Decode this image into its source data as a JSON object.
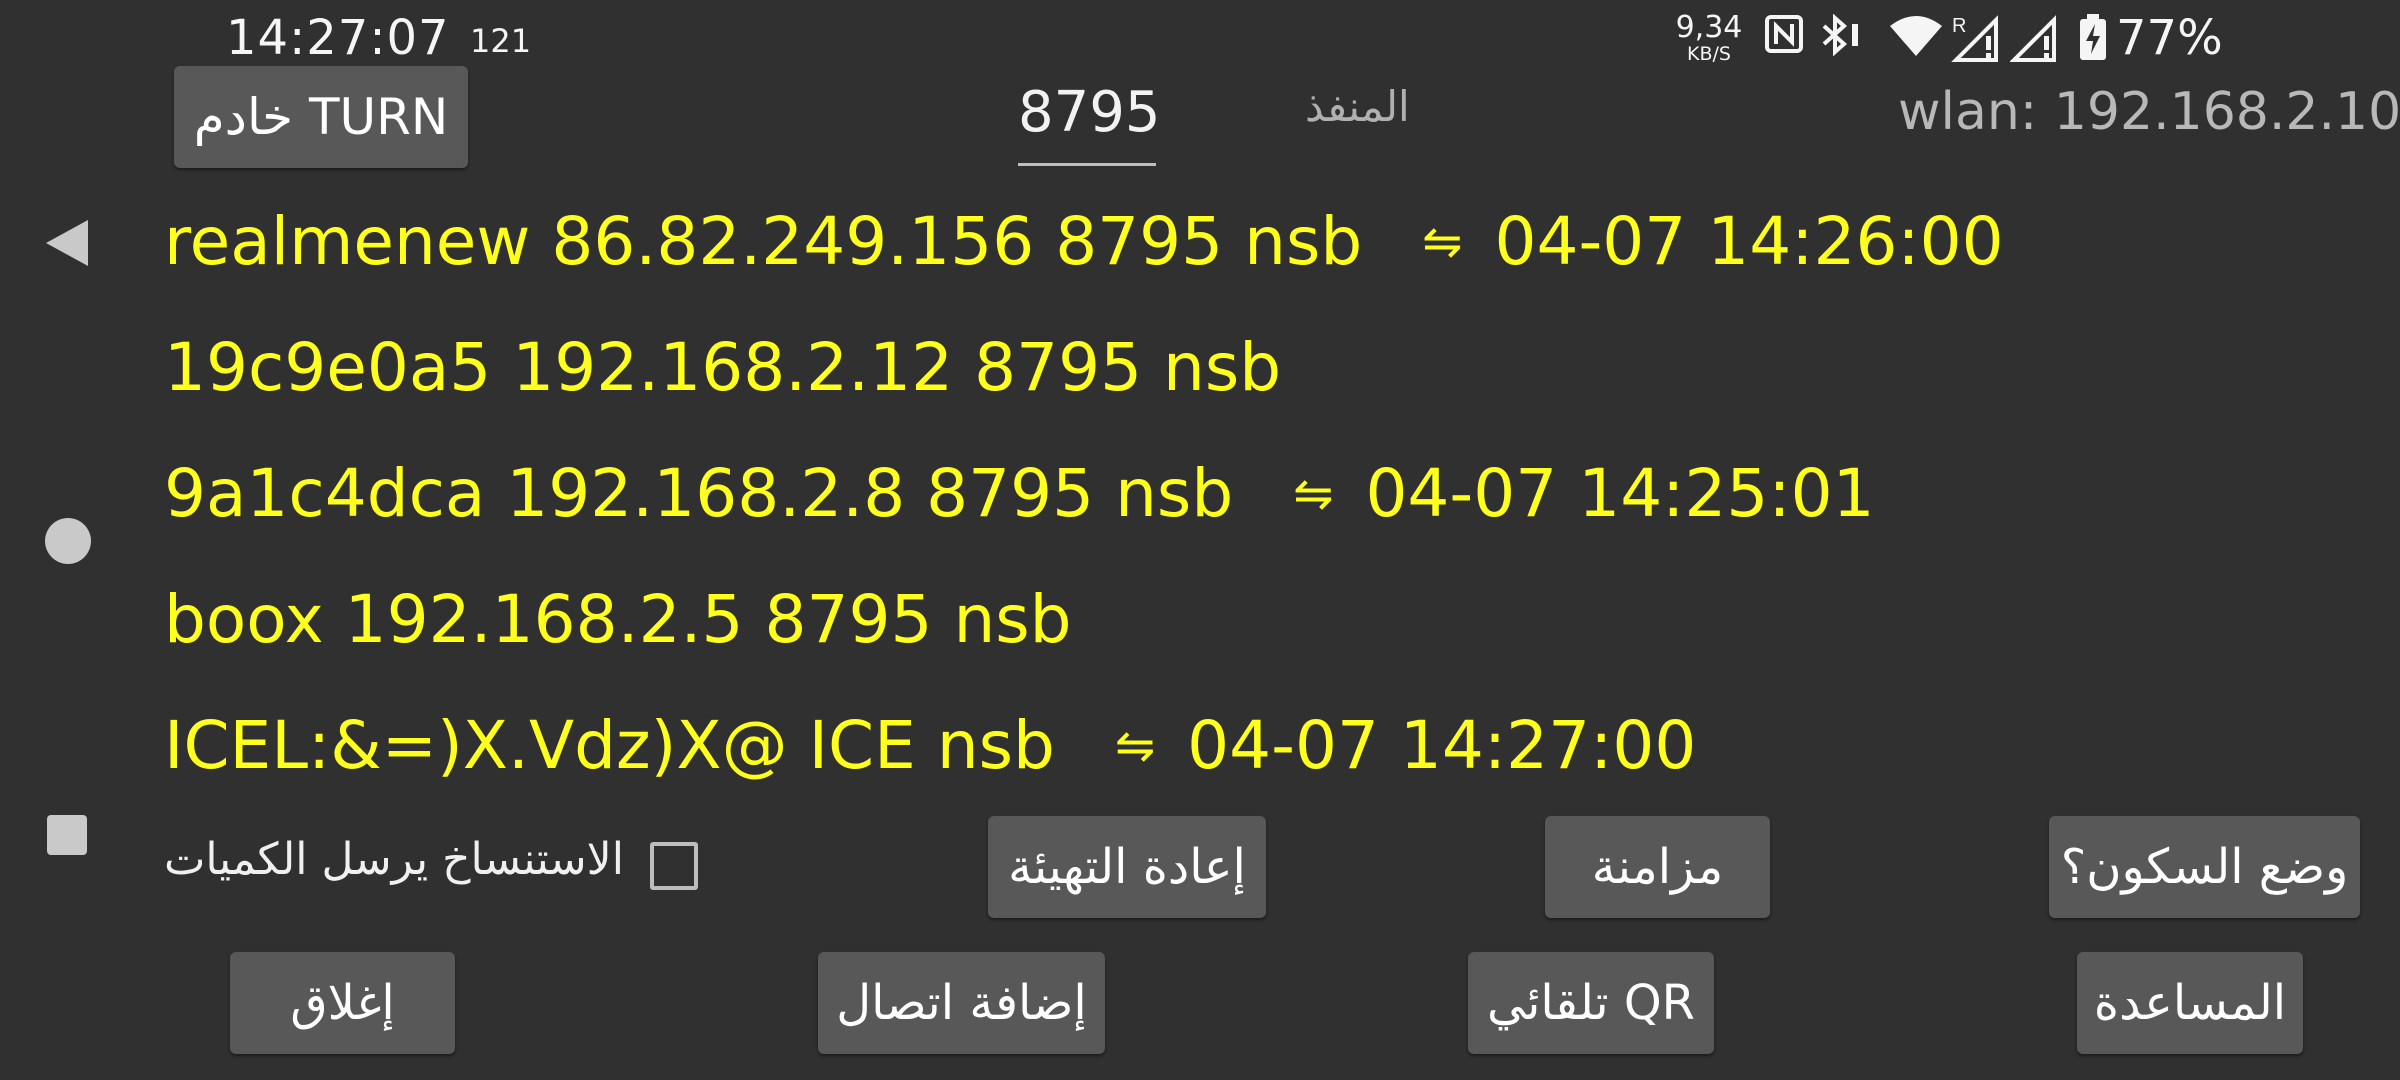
{
  "status_bar": {
    "time": "14:27:07",
    "notification_count": "121",
    "net_speed_value": "9,34",
    "net_speed_unit": "KB/S",
    "battery_percent": "77%",
    "icons": [
      "nfc-icon",
      "bluetooth-icon",
      "wifi-icon",
      "signal-roaming-icon",
      "signal-icon",
      "battery-charging-icon"
    ]
  },
  "header": {
    "turn_button": "خادم TURN",
    "port_value": "8795",
    "port_label": "المنفذ",
    "wlan": "wlan: 192.168.2.10"
  },
  "connections": [
    {
      "text": "realmenew 86.82.249.156 8795 nsb",
      "arrow": "⇋",
      "timestamp": "04-07 14:26:00"
    },
    {
      "text": "19c9e0a5 192.168.2.12 8795 nsb",
      "arrow": "",
      "timestamp": ""
    },
    {
      "text": "9a1c4dca 192.168.2.8 8795 nsb",
      "arrow": "⇋",
      "timestamp": "04-07 14:25:01"
    },
    {
      "text": "boox 192.168.2.5 8795 nsb",
      "arrow": "",
      "timestamp": ""
    },
    {
      "text": "ICEL:&=)X.Vdz)X@  ICE nsb",
      "arrow": "⇋",
      "timestamp": "04-07 14:27:00"
    }
  ],
  "options": {
    "checkbox_label": "الاستنساخ يرسل الكميات",
    "checkbox_checked": false,
    "reset_button": "إعادة التهيئة",
    "sync_button": "مزامنة",
    "sleep_mode_button": "وضع السكون؟"
  },
  "actions": {
    "close_button": "إغلاق",
    "add_connection_button": "إضافة اتصال",
    "qr_auto_button": "تلقائي QR",
    "help_button": "المساعدة"
  },
  "colors": {
    "background": "#303030",
    "connection_text": "#ffff1e",
    "button_bg": "#585858"
  }
}
